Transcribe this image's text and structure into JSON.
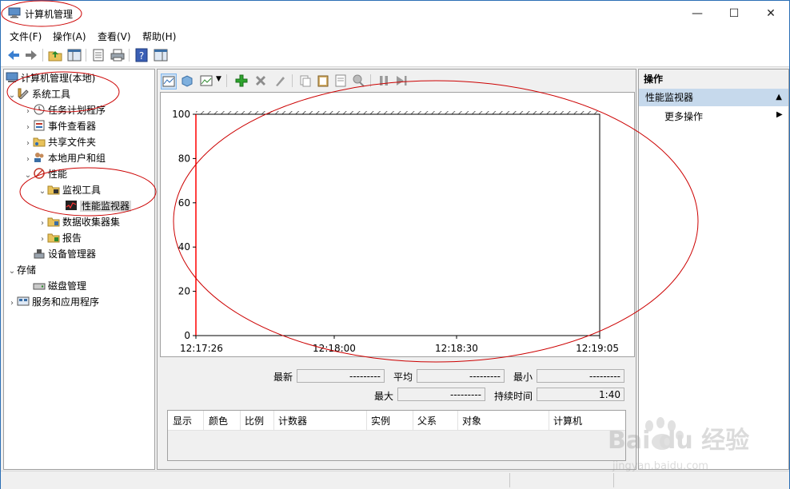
{
  "window": {
    "title": "计算机管理",
    "min": "—",
    "max": "☐",
    "close": "✕"
  },
  "menu": [
    "文件(F)",
    "操作(A)",
    "查看(V)",
    "帮助(H)"
  ],
  "tree": {
    "root": "计算机管理(本地)",
    "system_tools": "系统工具",
    "task_scheduler": "任务计划程序",
    "event_viewer": "事件查看器",
    "shared_folders": "共享文件夹",
    "local_users": "本地用户和组",
    "performance": "性能",
    "monitoring_tools": "监视工具",
    "perf_monitor": "性能监视器",
    "data_collector_sets": "数据收集器集",
    "reports": "报告",
    "device_manager": "设备管理器",
    "storage": "存储",
    "disk_management": "磁盘管理",
    "services_apps": "服务和应用程序"
  },
  "chart_data": {
    "type": "line",
    "x_tick_labels": [
      "12:17:26",
      "12:18:00",
      "12:18:30",
      "12:19:05"
    ],
    "y_tick_labels": [
      "100",
      "80",
      "60",
      "40",
      "20",
      "0"
    ],
    "ylim": [
      0,
      100
    ],
    "series": [],
    "grid": false
  },
  "stats": {
    "last_label": "最新",
    "last_value": "---------",
    "average_label": "平均",
    "average_value": "---------",
    "minimum_label": "最小",
    "minimum_value": "---------",
    "maximum_label": "最大",
    "maximum_value": "---------",
    "duration_label": "持续时间",
    "duration_value": "1:40"
  },
  "legend_columns": [
    "显示",
    "颜色",
    "比例",
    "计数器",
    "实例",
    "父系",
    "对象",
    "计算机"
  ],
  "actions": {
    "title": "操作",
    "section": "性能监视器",
    "more": "更多操作"
  },
  "watermark": {
    "brand": "Bai du 经验",
    "url": "jingyan.baidu.com"
  },
  "colors": {
    "annotation": "#cc0000",
    "graph_line": "#ff0000",
    "selected_section": "#c6d9ec",
    "title_border": "#2b6fb5"
  }
}
